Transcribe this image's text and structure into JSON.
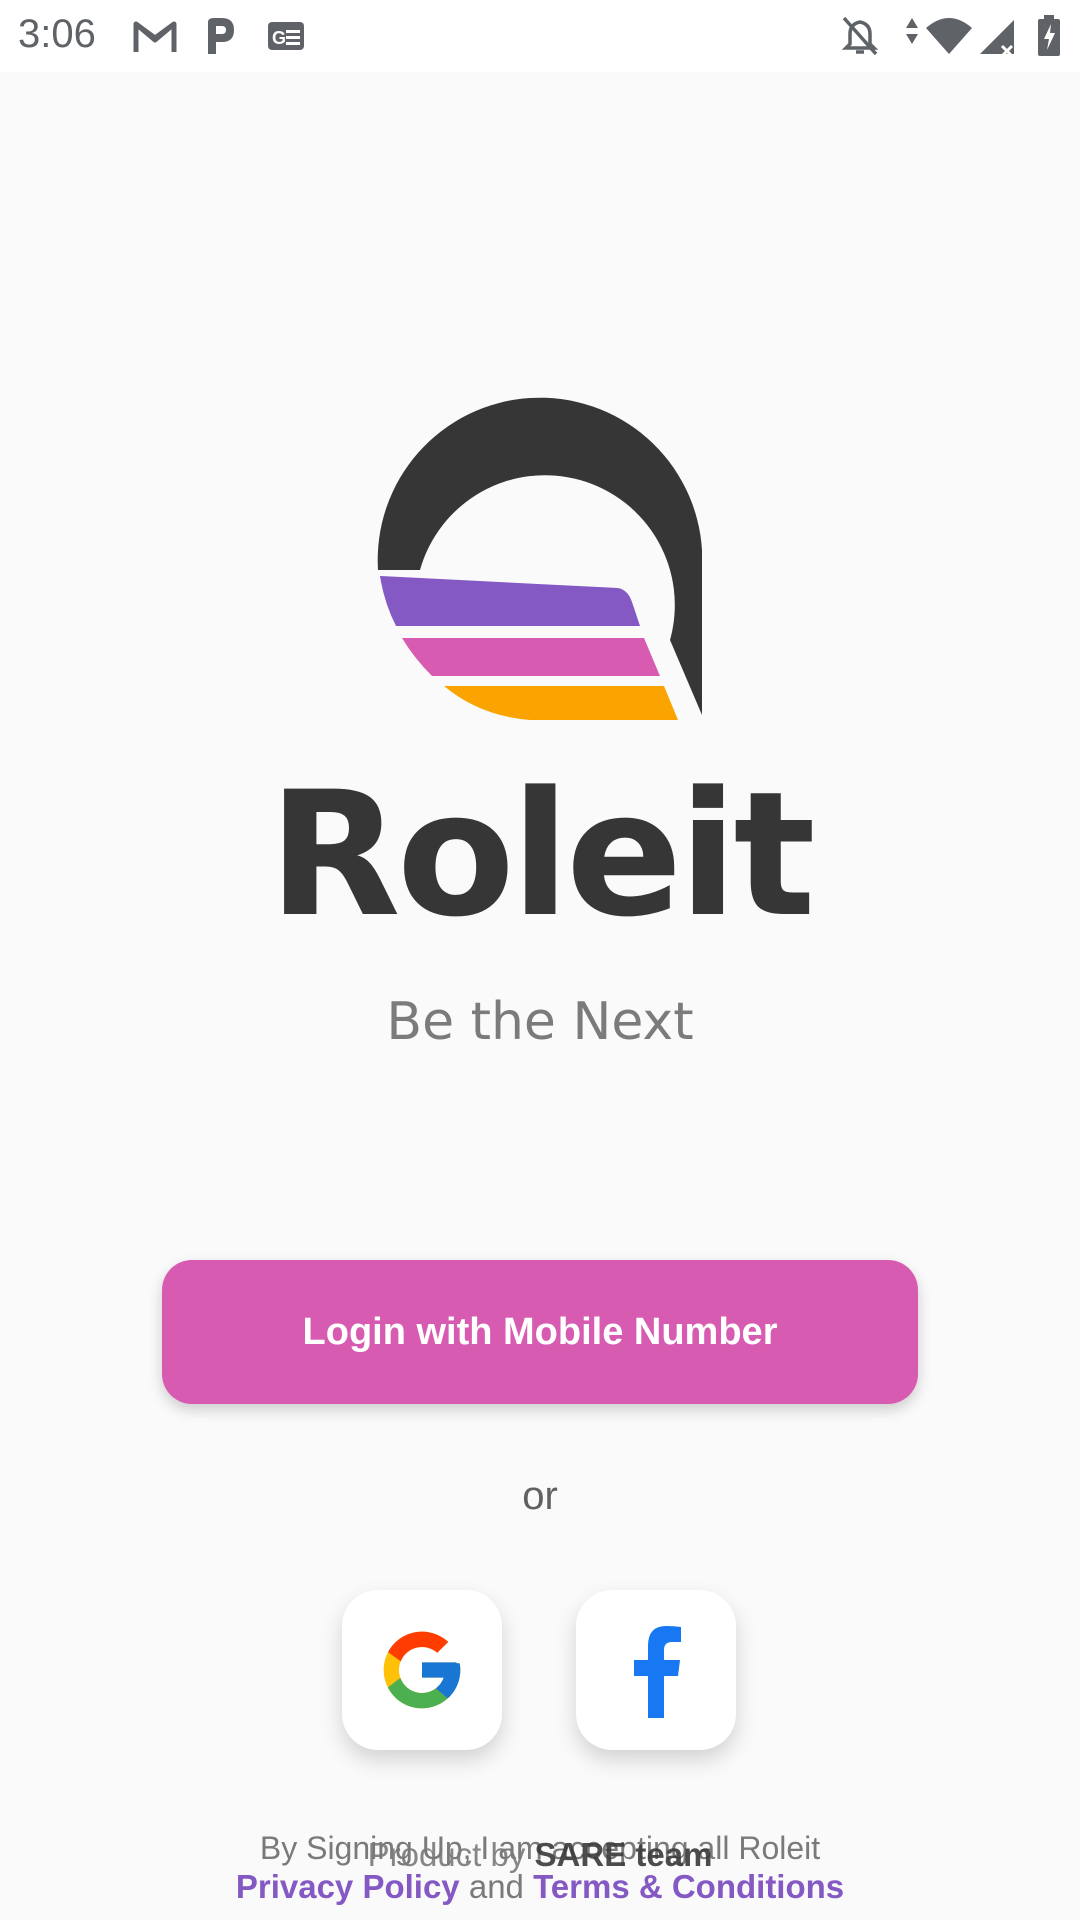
{
  "status_bar": {
    "time": "3:06",
    "notification_icons": [
      "gmail-icon",
      "p-app-icon",
      "news-icon"
    ],
    "system_icons": [
      "bell-off-icon",
      "data-arrows-icon",
      "wifi-icon",
      "signal-icon",
      "battery-charging-icon"
    ]
  },
  "brand": {
    "name": "Roleit",
    "tagline": "Be the Next",
    "colors": {
      "dark": "#363636",
      "purple": "#8559c4",
      "pink": "#d75cb1",
      "orange": "#fba400"
    }
  },
  "actions": {
    "login_label": "Login with Mobile Number",
    "or_label": "or",
    "google_icon": "google-icon",
    "facebook_icon": "facebook-icon"
  },
  "footer": {
    "product_prefix": "Product by ",
    "product_team": "SARE team",
    "consent_text": "By Signing Up, I am accepting all Roleit",
    "privacy_label": "Privacy Policy",
    "and_label": " and ",
    "terms_label": "Terms & Conditions"
  }
}
